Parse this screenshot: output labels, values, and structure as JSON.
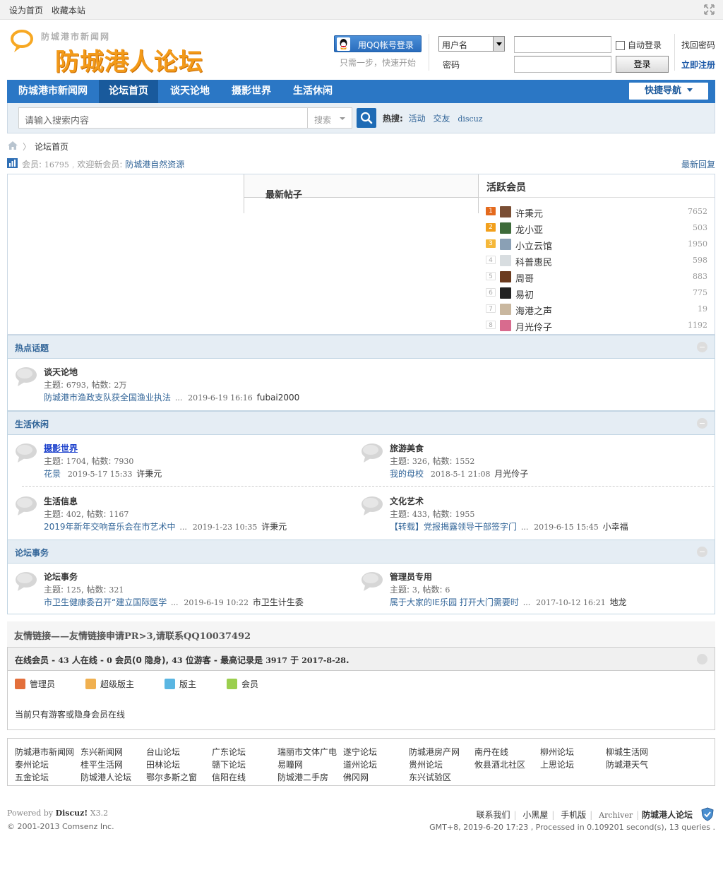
{
  "topbar": {
    "set_home": "设为首页",
    "bookmark": "收藏本站"
  },
  "logo": {
    "subtitle": "防城港市新闻网",
    "title": "防城港人论坛",
    "color": "#f39a19"
  },
  "login": {
    "qq_button": "用QQ帐号登录",
    "qq_hint": "只需一步，快速开始",
    "login_type": "用户名",
    "password_label": "密码",
    "username_value": "",
    "password_value": "",
    "auto_login": "自动登录",
    "login_button": "登录",
    "find_password": "找回密码",
    "register": "立即注册"
  },
  "nav": {
    "items": [
      "防城港市新闻网",
      "论坛首页",
      "谈天论地",
      "摄影世界",
      "生活休闲"
    ],
    "active": "论坛首页",
    "quick_nav": "快捷导航",
    "color": "#2b77c5"
  },
  "search": {
    "placeholder": "请输入搜索内容",
    "type": "搜索",
    "hot_label": "热搜:",
    "hot_terms": [
      "活动",
      "交友",
      "discuz"
    ]
  },
  "breadcrumb": {
    "current": "论坛首页"
  },
  "stats": {
    "members_label": "会员:",
    "members": "16795",
    "welcome_label": "欢迎新会员:",
    "new_member": "防城港自然资源",
    "latest_reply": "最新回复"
  },
  "newest_posts": {
    "title": "最新帖子"
  },
  "active_members": {
    "title": "活跃会员",
    "list": [
      {
        "rank": "1",
        "name": "许秉元",
        "count": "7652"
      },
      {
        "rank": "2",
        "name": "龙小亚",
        "count": "503"
      },
      {
        "rank": "3",
        "name": "小立云馆",
        "count": "1950"
      },
      {
        "rank": "4",
        "name": "科普惠民",
        "count": "598"
      },
      {
        "rank": "5",
        "name": "周哥",
        "count": "883"
      },
      {
        "rank": "6",
        "name": "易初",
        "count": "775"
      },
      {
        "rank": "7",
        "name": "海港之声",
        "count": "19"
      },
      {
        "rank": "8",
        "name": "月光伶子",
        "count": "1192"
      }
    ]
  },
  "sections": [
    {
      "title": "热点话题",
      "forums": [
        {
          "name": "谈天论地",
          "topics_label": "主题:",
          "topics": "6793",
          "posts_label": "帖数:",
          "posts": "2万",
          "last_title": "防城港市渔政支队获全国渔业执法",
          "ellipsis": "...",
          "last_time": "2019-6-19 16:16",
          "last_user": "fubai2000"
        }
      ]
    },
    {
      "title": "生活休闲",
      "forums": [
        {
          "name": "摄影世界",
          "topics_label": "主题:",
          "topics": "1704",
          "posts_label": "帖数:",
          "posts": "7930",
          "last_title": "花景",
          "ellipsis": "",
          "last_time": "2019-5-17 15:33",
          "last_user": "许秉元"
        },
        {
          "name": "旅游美食",
          "topics_label": "主题:",
          "topics": "326",
          "posts_label": "帖数:",
          "posts": "1552",
          "last_title": "我的母校",
          "ellipsis": "",
          "last_time": "2018-5-1 21:08",
          "last_user": "月光伶子"
        },
        {
          "name": "生活信息",
          "topics_label": "主题:",
          "topics": "402",
          "posts_label": "帖数:",
          "posts": "1167",
          "last_title": "2019年新年交响音乐会在市艺术中",
          "ellipsis": "...",
          "last_time": "2019-1-23 10:35",
          "last_user": "许秉元"
        },
        {
          "name": "文化艺术",
          "topics_label": "主题:",
          "topics": "433",
          "posts_label": "帖数:",
          "posts": "1955",
          "last_title": "【转载】党报揭露领导干部签字门",
          "ellipsis": "...",
          "last_time": "2019-6-15 15:45",
          "last_user": "小幸福"
        }
      ]
    },
    {
      "title": "论坛事务",
      "forums": [
        {
          "name": "论坛事务",
          "topics_label": "主题:",
          "topics": "125",
          "posts_label": "帖数:",
          "posts": "321",
          "last_title": "市卫生健康委召开“建立国际医学",
          "ellipsis": "...",
          "last_time": "2019-6-19 10:22",
          "last_user": "市卫生计生委"
        },
        {
          "name": "管理员专用",
          "topics_label": "主题:",
          "topics": "3",
          "posts_label": "帖数:",
          "posts": "6",
          "last_title": "属于大家的IE乐园 打开大门需要时",
          "ellipsis": "...",
          "last_time": "2017-10-12 16:21",
          "last_user": "地龙"
        }
      ]
    }
  ],
  "friend_links_title": "友情链接——友情链接申请PR>3,请联系QQ10037492",
  "online": {
    "prefix": "在线会员 - ",
    "total": "43",
    "mid1": " 人在线 - ",
    "members": "0",
    "mid2": " 会员(0 隐身), ",
    "guests": "43",
    "mid3": " 位游客 - 最高记录是 ",
    "record": "3917",
    "mid4": " 于 ",
    "record_date": "2017-8-28",
    "suffix": ".",
    "legend": [
      "管理员",
      "超级版主",
      "版主",
      "会员"
    ],
    "note": "当前只有游客或隐身会员在线"
  },
  "links": [
    "防城港市新闻网",
    "东兴新闻网",
    "台山论坛",
    "广东论坛",
    "瑞丽市文体广电",
    "遂宁论坛",
    "防城港房产网",
    "南丹在线",
    "柳州论坛",
    "柳城生活网",
    "泰州论坛",
    "桂平生活网",
    "田林论坛",
    "赣下论坛",
    "易瞳网",
    "道州论坛",
    "贵州论坛",
    "攸县酒北社区",
    "上思论坛",
    "防城港天气",
    "五金论坛",
    "防城港人论坛",
    "鄂尔多斯之窗",
    "信阳在线",
    "防城港二手房",
    "佛冈网",
    "东兴试验区"
  ],
  "footer": {
    "powered_by": "Powered by",
    "discuz": "Discuz!",
    "version": "X3.2",
    "copyright": "© 2001-2013 Comsenz Inc.",
    "links": [
      "联系我们",
      "小黑屋",
      "手机版",
      "Archiver",
      "防城港人论坛"
    ],
    "gmt": "GMT+8, 2019-6-20 17:23 , Processed in 0.109201 second(s), 13 queries ."
  }
}
